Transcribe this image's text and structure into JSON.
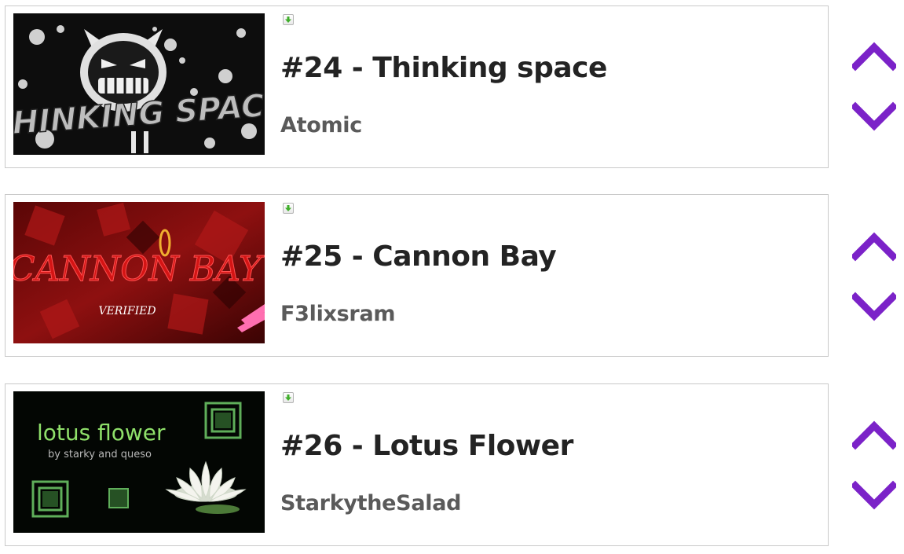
{
  "levels": [
    {
      "rank": "#24",
      "separator": "-",
      "title": "#24 - Thinking space",
      "author": "Atomic",
      "thumbnail": {
        "text": "THINKING SPACE"
      }
    },
    {
      "rank": "#25",
      "separator": "-",
      "title": "#25 - Cannon Bay",
      "author": "F3lixsram",
      "thumbnail": {
        "text": "CANNON BAY",
        "subtext": "VERIFIED"
      }
    },
    {
      "rank": "#26",
      "separator": "-",
      "title": "#26 - Lotus Flower",
      "author": "StarkytheSalad",
      "thumbnail": {
        "text": "lotus flower",
        "subtext": "by starky and queso"
      }
    }
  ],
  "icons": {
    "download": "download-icon",
    "move_up": "chevron-up-icon",
    "move_down": "chevron-down-icon"
  },
  "colors": {
    "accent": "#7b22c8",
    "title": "#232323",
    "author": "#5a5a5a",
    "border": "#c9c9c9",
    "download_arrow": "#3fae2a"
  }
}
